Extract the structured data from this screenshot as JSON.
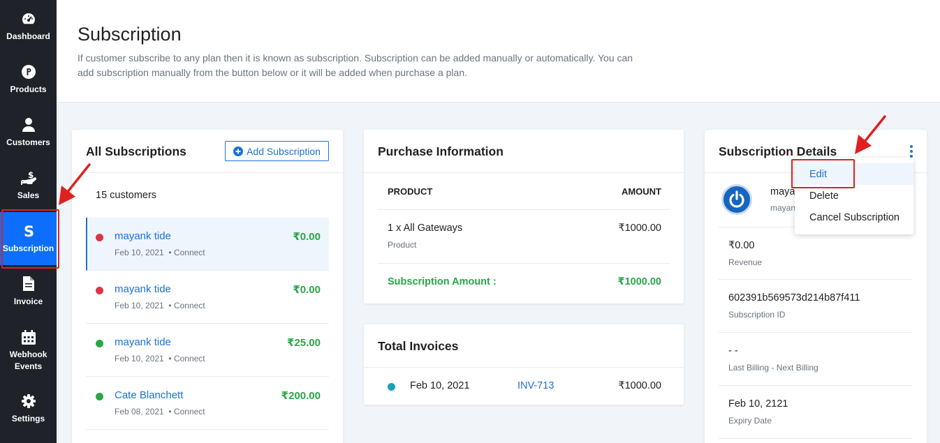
{
  "sidebar": {
    "items": [
      {
        "label": "Dashboard",
        "icon": "dashboard-icon"
      },
      {
        "label": "Products",
        "icon": "products-icon"
      },
      {
        "label": "Customers",
        "icon": "user-icon"
      },
      {
        "label": "Sales",
        "icon": "sales-icon"
      },
      {
        "label": "Subscription",
        "icon": "subscription-icon",
        "active": true
      },
      {
        "label": "Invoice",
        "icon": "document-icon"
      },
      {
        "label": "Webhook Events",
        "icon": "calendar-icon"
      },
      {
        "label": "Settings",
        "icon": "gear-icon"
      }
    ]
  },
  "header": {
    "title": "Subscription",
    "description": "If customer subscribe to any plan then it is known as subscription. Subscription can be added manually or automatically. You can add subscription manually from the button below or it will be added when purchase a plan."
  },
  "all_subscriptions": {
    "title": "All Subscriptions",
    "add_label": "Add Subscription",
    "count": "15 customers",
    "rows": [
      {
        "name": "mayank tide",
        "date": "Feb 10, 2021",
        "source": "• Connect",
        "amount": "₹0.00",
        "status_color": "#dc3545"
      },
      {
        "name": "mayank tide",
        "date": "Feb 10, 2021",
        "source": "• Connect",
        "amount": "₹0.00",
        "status_color": "#dc3545"
      },
      {
        "name": "mayank tide",
        "date": "Feb 10, 2021",
        "source": "• Connect",
        "amount": "₹25.00",
        "status_color": "#28a745"
      },
      {
        "name": "Cate Blanchett",
        "date": "Feb 08, 2021",
        "source": "• Connect",
        "amount": "₹200.00",
        "status_color": "#28a745"
      }
    ]
  },
  "purchase_info": {
    "title": "Purchase Information",
    "col_product": "PRODUCT",
    "col_amount": "AMOUNT",
    "item": {
      "name": "1 x All Gateways",
      "type": "Product",
      "amount": "₹1000.00"
    },
    "total_label": "Subscription Amount :",
    "total_amount": "₹1000.00"
  },
  "total_invoices": {
    "title": "Total Invoices",
    "rows": [
      {
        "date": "Feb 10, 2021",
        "invoice": "INV-713",
        "amount": "₹1000.00"
      }
    ]
  },
  "details": {
    "title": "Subscription Details",
    "customer_name": "maya",
    "customer_sub": "mayan",
    "fields": [
      {
        "value": "₹0.00",
        "label": "Revenue"
      },
      {
        "value": "602391b569573d214b87f411",
        "label": "Subscription ID"
      },
      {
        "value": "- -",
        "label": "Last Billing - Next Billing"
      },
      {
        "value": "Feb 10, 2121",
        "label": "Expiry Date"
      }
    ]
  },
  "menu": {
    "items": [
      "Edit",
      "Delete",
      "Cancel Subscription"
    ]
  },
  "colors": {
    "sidebar_bg": "#1f2329",
    "accent": "#0d6efd",
    "link": "#1a73d6",
    "success": "#28a745",
    "danger": "#dc3545",
    "annotation": "#e02020"
  }
}
